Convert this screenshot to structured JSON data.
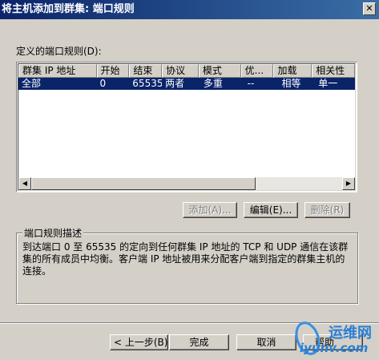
{
  "window": {
    "title": "将主机添加到群集: 端口规则",
    "close_glyph": "✕"
  },
  "rules_list": {
    "label": "定义的端口规则(D):",
    "columns": [
      "群集 IP 地址",
      "开始",
      "结束",
      "协议",
      "模式",
      "优...",
      "加载",
      "相关性"
    ],
    "rows": [
      [
        "全部",
        "0",
        "65535",
        "两者",
        "多重",
        "--",
        "相等",
        "单一"
      ]
    ]
  },
  "list_buttons": {
    "add": "添加(A)...",
    "edit": "编辑(E)...",
    "remove": "删除(R)"
  },
  "description": {
    "title": "端口规则描述",
    "text": "到达端口 0 至 65535 的定向到任何群集 IP 地址的 TCP 和 UDP 通信在该群集的所有成员中均衡。客户端 IP 地址被用来分配客户端到指定的群集主机的连接。"
  },
  "footer_buttons": {
    "back": "< 上一步(B)",
    "finish": "完成",
    "cancel": "取消",
    "help": "帮助"
  },
  "watermark": {
    "cn": "运维网",
    "en": "iyunv.com"
  }
}
